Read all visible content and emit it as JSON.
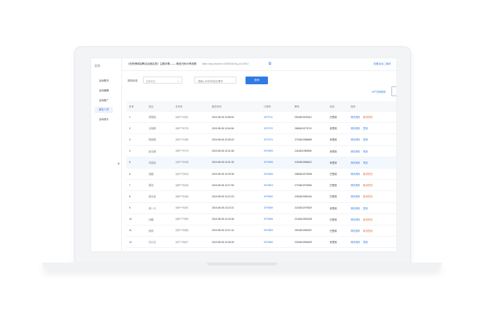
{
  "sidebar": {
    "logo": "后台",
    "items": [
      "活动概况",
      "活动编辑",
      "活动推广",
      "报名人员",
      "活动统计"
    ],
    "active_index": 3
  },
  "topbar": {
    "title": "《在职博硕招聘活动报名表》主题详情 —— 微信扫码分享查看",
    "url": "https://wap.chaoshi.cn/1806310/ng_id=18410",
    "right_link": "查看活动二维码"
  },
  "filter": {
    "label": "报到状态",
    "select_placeholder": "选择状态",
    "search_placeholder": "请输入手机号/姓名/票号",
    "query_button": "查询"
  },
  "export_link": "APP扫码报到",
  "table": {
    "headers": [
      "序号",
      "姓名",
      "手机号",
      "报名时间",
      "订单号",
      "票号",
      "状态",
      "操作"
    ],
    "rows": [
      {
        "no": "1",
        "name": "李明浩",
        "phone": "186****4291",
        "time": "2019-08-05 13:56:52",
        "order": "3979711",
        "ticket": "2501801933312",
        "status": "已签到",
        "ops": [
          "修改资料",
          "取消签到"
        ]
      },
      {
        "no": "2",
        "name": "王晓燕",
        "phone": "186****8776",
        "time": "2019-08-05 13:54:54",
        "order": "3979702",
        "ticket": "2681801973712",
        "status": "未签到",
        "ops": [
          "修改资料",
          "签到"
        ]
      },
      {
        "no": "3",
        "name": "陈晓明",
        "phone": "185****1466",
        "time": "2019-08-05 13:35:22",
        "order": "3979701",
        "ticket": "2701801988669",
        "status": "未签到",
        "ops": [
          "修改资料",
          "签到"
        ]
      },
      {
        "no": "4",
        "name": "赵文静",
        "phone": "186****0776",
        "time": "2019-08-05 13:31:56",
        "order": "3979699",
        "ticket": "2411801989906",
        "status": "未签到",
        "ops": [
          "修改资料",
          "签到"
        ]
      },
      {
        "no": "5",
        "name": "刘佳佳",
        "phone": "136****5438",
        "time": "2019-08-05 13:31:30",
        "order": "3979698",
        "ticket": "2431801986612",
        "status": "未签到",
        "ops": [
          "修改资料",
          "签到"
        ]
      },
      {
        "no": "6",
        "name": "张磊",
        "phone": "183****0916",
        "time": "2019-08-05 13:29:39",
        "order": "3979695",
        "ticket": "2581801979908",
        "status": "已签到",
        "ops": [
          "修改资料",
          "取消签到"
        ]
      },
      {
        "no": "7",
        "name": "周洋",
        "phone": "188****6226",
        "time": "2019-08-05 13:27:50",
        "order": "3979693",
        "ticket": "2721801975953",
        "status": "已签到",
        "ops": [
          "修改资料",
          "取消签到"
        ]
      },
      {
        "no": "8",
        "name": "吴文龙",
        "phone": "188****6336",
        "time": "2019-08-05 13:22:23",
        "order": "3979690",
        "ticket": "2251801980442",
        "status": "已签到",
        "ops": [
          "修改资料",
          "取消签到"
        ]
      },
      {
        "no": "9",
        "name": "郑一凡",
        "phone": "186****6291",
        "time": "2019-08-05 13:22:21",
        "order": "3979689",
        "ticket": "2221801975529",
        "status": "未签到",
        "ops": [
          "修改资料",
          "签到"
        ]
      },
      {
        "no": "10",
        "name": "孙鹏",
        "phone": "188****7983",
        "time": "2019-08-05 13:16:36",
        "order": "3979686",
        "ticket": "2131801984028",
        "status": "已签到",
        "ops": [
          "修改资料",
          "取消签到"
        ]
      },
      {
        "no": "11",
        "name": "钱伟",
        "phone": "189****6568",
        "time": "2019-08-05 13:07:42",
        "order": "3979683",
        "ticket": "2521801982607",
        "status": "已签到",
        "ops": [
          "修改资料",
          "取消签到"
        ]
      },
      {
        "no": "12",
        "name": "冯小玉",
        "phone": "187****6627",
        "time": "2019-08-05 13:05:26",
        "order": "3979680",
        "ticket": "2331801983629",
        "status": "未签到",
        "ops": [
          "修改资料",
          "签到"
        ]
      },
      {
        "no": "13",
        "name": "杜雅楠",
        "phone": "166****6986",
        "time": "2019-08-05 13:06:01",
        "order": "3979678",
        "ticket": "2781801981647",
        "status": "未签到",
        "ops": [
          "修改资料",
          "签到"
        ]
      }
    ],
    "highlight_row": 4
  }
}
